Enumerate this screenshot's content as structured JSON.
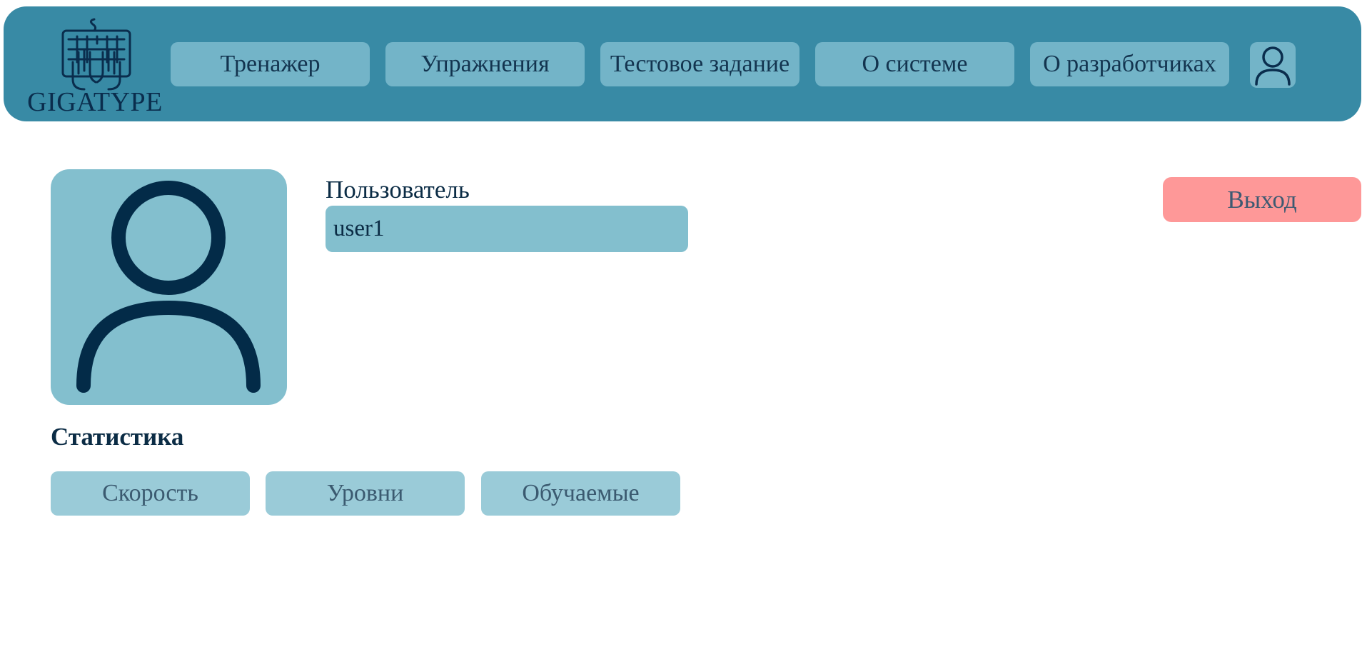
{
  "app": {
    "logo_text": "GIGATYPE",
    "logo_icon": "keyboard-hands-icon"
  },
  "nav": {
    "items": [
      {
        "label": "Тренажер"
      },
      {
        "label": "Упражнения"
      },
      {
        "label": "Тестовое задание"
      },
      {
        "label": "О системе"
      },
      {
        "label": "О разработчиках"
      }
    ],
    "profile_icon": "user-icon"
  },
  "profile": {
    "avatar_icon": "user-icon",
    "username_label": "Пользователь",
    "username_value": "user1",
    "logout_label": "Выход"
  },
  "statistics": {
    "title": "Статистика",
    "tabs": [
      {
        "label": "Скорость"
      },
      {
        "label": "Уровни"
      },
      {
        "label": "Обучаемые"
      }
    ]
  },
  "colors": {
    "header_bg": "#388aa5",
    "nav_button": "#73b4c8",
    "avatar_bg": "#83bfce",
    "stat_button": "#9acbd8",
    "logout": "#fe9898",
    "text_dark": "#0b2c45"
  }
}
